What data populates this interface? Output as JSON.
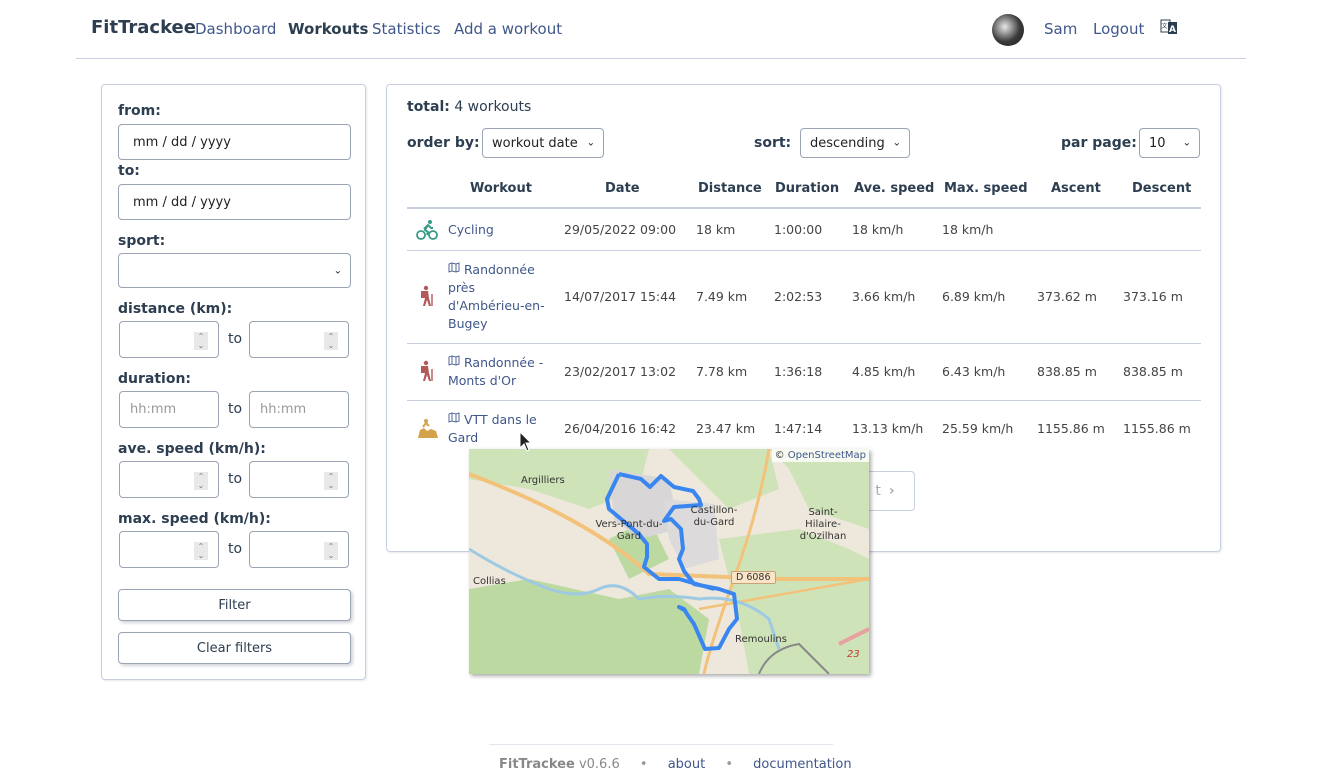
{
  "navbar": {
    "brand": "FitTrackee",
    "links": [
      "Dashboard",
      "Workouts",
      "Statistics",
      "Add a workout"
    ],
    "active": "Workouts",
    "username": "Sam",
    "logout": "Logout"
  },
  "filters": {
    "from_label": "from:",
    "from_placeholder": "mm / dd / yyyy",
    "to_label": "to:",
    "to_placeholder": "mm / dd / yyyy",
    "sport_label": "sport:",
    "sport_value": "",
    "distance_label": "distance (km):",
    "duration_label": "duration:",
    "duration_placeholder": "hh:mm",
    "ave_speed_label": "ave. speed (km/h):",
    "max_speed_label": "max. speed (km/h):",
    "to_word": "to",
    "filter_button": "Filter",
    "clear_button": "Clear filters"
  },
  "workouts": {
    "total_label": "total:",
    "total_value": "4 workouts",
    "order_by_label": "order by:",
    "order_by_value": "workout date",
    "sort_label": "sort:",
    "sort_value": "descending",
    "per_page_label": "par page:",
    "per_page_value": "10",
    "columns": [
      "Workout",
      "Date",
      "Distance",
      "Duration",
      "Ave. speed",
      "Max. speed",
      "Ascent",
      "Descent"
    ],
    "rows": [
      {
        "sport": "cycling",
        "title": "Cycling",
        "has_map": false,
        "date": "29/05/2022 09:00",
        "distance": "18 km",
        "duration": "1:00:00",
        "ave_speed": "18 km/h",
        "max_speed": "18 km/h",
        "ascent": "",
        "descent": ""
      },
      {
        "sport": "hiking",
        "title": "Randonnée près d'Ambérieu-en-Bugey",
        "has_map": true,
        "date": "14/07/2017 15:44",
        "distance": "7.49 km",
        "duration": "2:02:53",
        "ave_speed": "3.66 km/h",
        "max_speed": "6.89 km/h",
        "ascent": "373.62 m",
        "descent": "373.16 m"
      },
      {
        "sport": "hiking",
        "title": "Randonnée - Monts d'Or",
        "has_map": true,
        "date": "23/02/2017 13:02",
        "distance": "7.78 km",
        "duration": "1:36:18",
        "ave_speed": "4.85 km/h",
        "max_speed": "6.43 km/h",
        "ascent": "838.85 m",
        "descent": "838.85 m"
      },
      {
        "sport": "mountain-biking",
        "title": "VTT dans le Gard",
        "has_map": true,
        "date": "26/04/2016 16:42",
        "distance": "23.47 km",
        "duration": "1:47:14",
        "ave_speed": "13.13 km/h",
        "max_speed": "25.59 km/h",
        "ascent": "1155.86 m",
        "descent": "1155.86 m"
      }
    ],
    "pagination_next": "t"
  },
  "map_popup": {
    "attribution_prefix": "©",
    "attribution": "OpenStreetMap",
    "places": [
      "Argilliers",
      "Vers-Pont-du-Gard",
      "Castillon-du-Gard",
      "Saint-Hilaire-d'Ozilhan",
      "Collias",
      "Remoulins"
    ],
    "road_label": "D 6086",
    "road_number": "23",
    "track_color": "#3a86f0"
  },
  "colors": {
    "link": "#40578a",
    "heading": "#2c3e50",
    "cycling": "#3a9a86",
    "hiking": "#b5585a",
    "mountain_biking": "#d4a24a"
  },
  "footer": {
    "brand": "FitTrackee",
    "version": "v0.6.6",
    "about": "about",
    "documentation": "documentation"
  }
}
